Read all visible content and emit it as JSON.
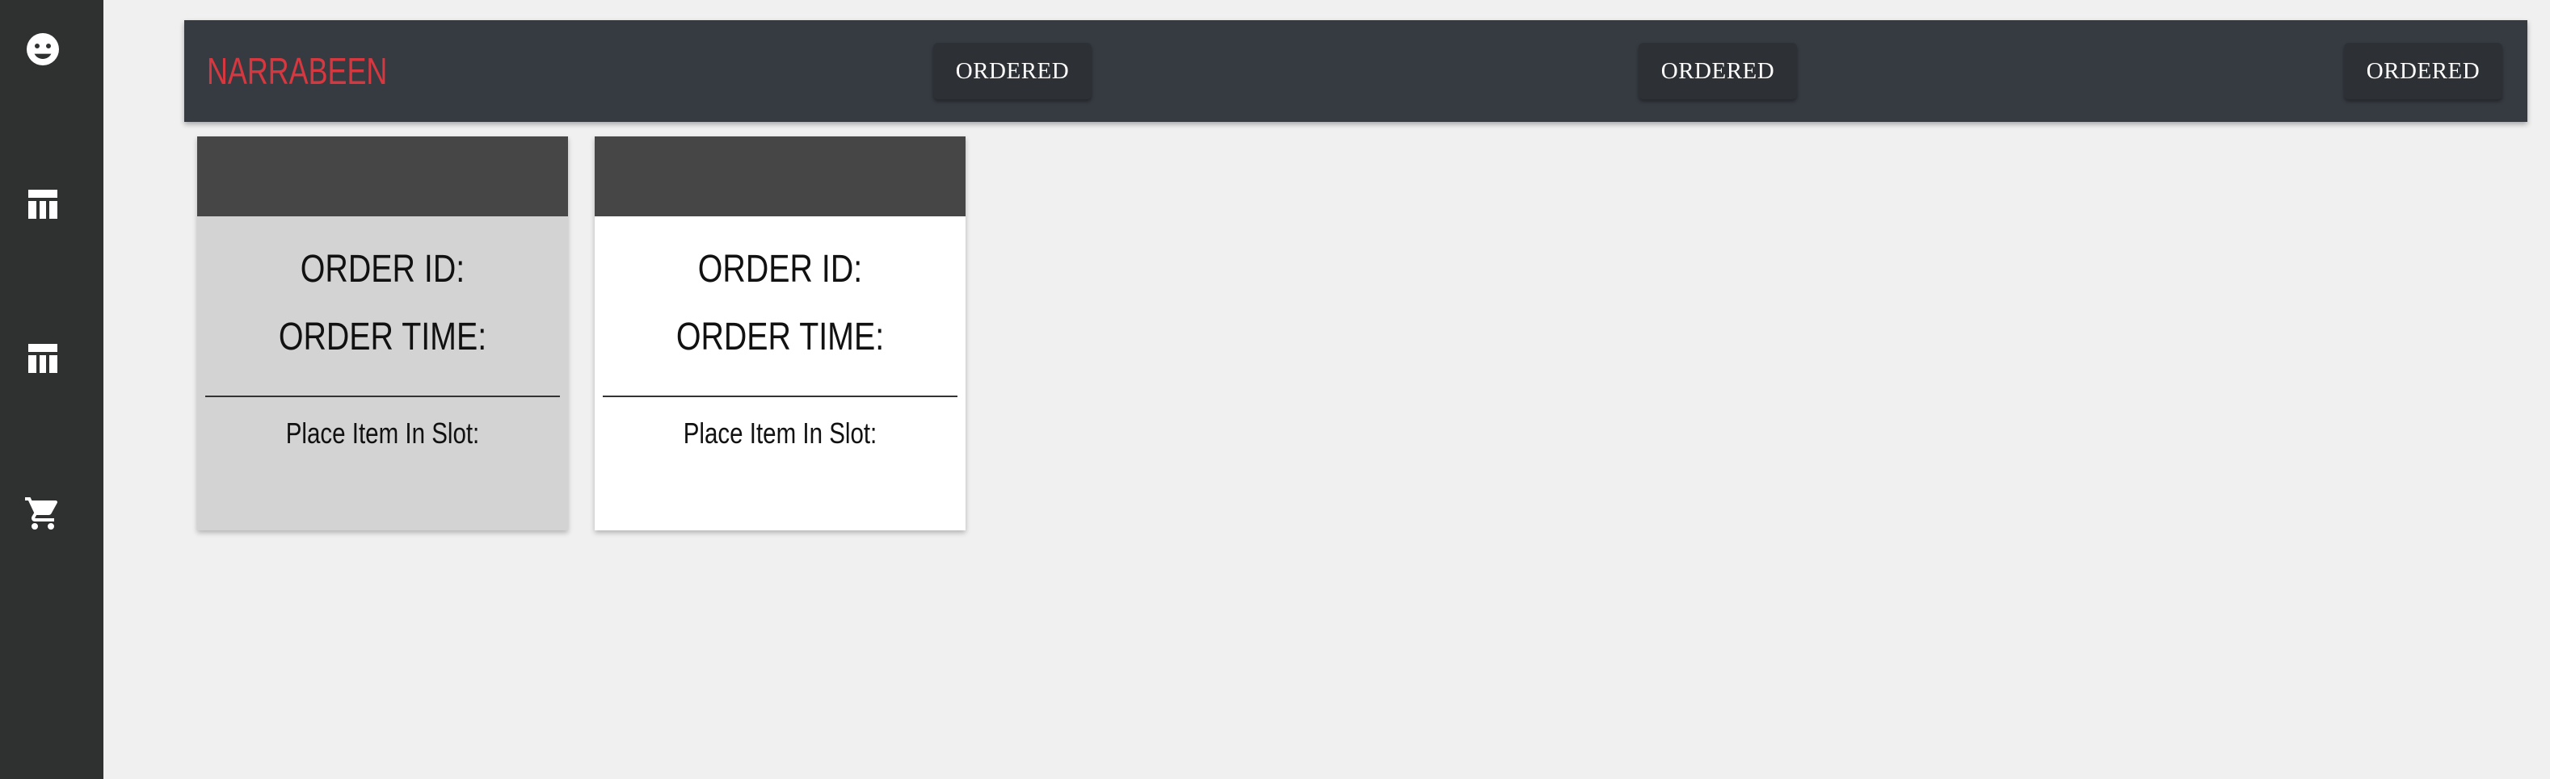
{
  "sidebar": {
    "items": [
      {
        "icon": "tag-face-icon"
      },
      {
        "icon": "table-icon"
      },
      {
        "icon": "table-icon"
      },
      {
        "icon": "cart-icon"
      }
    ]
  },
  "topbar": {
    "brand": "NARRABEEN",
    "status_buttons": [
      "ORDERED",
      "ORDERED",
      "ORDERED"
    ]
  },
  "cards": [
    {
      "order_id_label": "ORDER ID:",
      "order_time_label": "ORDER TIME:",
      "slot_label": "Place Item In Slot:",
      "background": "#d3d3d3"
    },
    {
      "order_id_label": "ORDER ID:",
      "order_time_label": "ORDER TIME:",
      "slot_label": "Place Item In Slot:",
      "background": "#ffffff"
    }
  ],
  "colors": {
    "sidebar": "#2f3130",
    "topbar": "#363b42",
    "brand": "#d7373f",
    "card_header": "#464646"
  }
}
